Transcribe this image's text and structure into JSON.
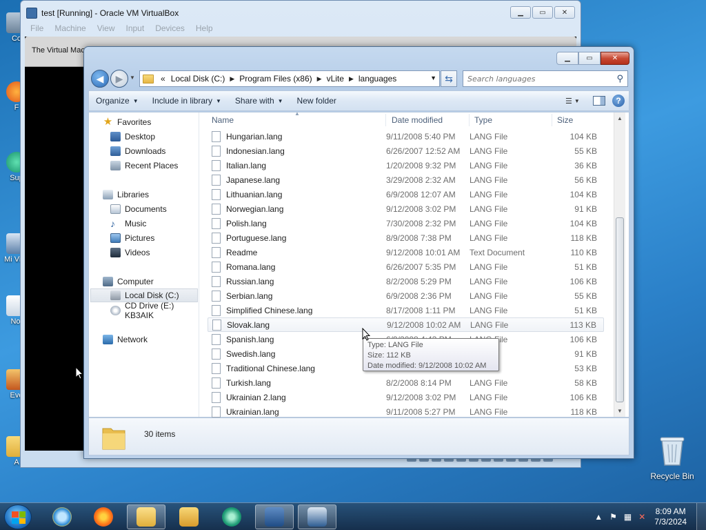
{
  "desktop": {
    "icons": [
      {
        "label": "Co"
      },
      {
        "label": "F"
      },
      {
        "label": "Sup"
      },
      {
        "label": "Mi Visu"
      },
      {
        "label": "Not"
      },
      {
        "label": "Eve"
      },
      {
        "label": "A"
      }
    ],
    "recycle_bin": "Recycle Bin"
  },
  "virtualbox": {
    "title": "test [Running] - Oracle VM VirtualBox",
    "menu": [
      "File",
      "Machine",
      "View",
      "Input",
      "Devices",
      "Help"
    ],
    "banner": "The Virtual Mac"
  },
  "explorer": {
    "breadcrumb": [
      "Local Disk (C:)",
      "Program Files (x86)",
      "vLite",
      "languages"
    ],
    "breadcrumb_prefix": "«",
    "search_placeholder": "Search languages",
    "toolbar": {
      "organize": "Organize",
      "include_in_library": "Include in library",
      "share_with": "Share with",
      "new_folder": "New folder"
    },
    "nav": {
      "favorites": "Favorites",
      "desktop": "Desktop",
      "downloads": "Downloads",
      "recent_places": "Recent Places",
      "libraries": "Libraries",
      "documents": "Documents",
      "music": "Music",
      "pictures": "Pictures",
      "videos": "Videos",
      "computer": "Computer",
      "local_disk": "Local Disk (C:)",
      "cd_drive": "CD Drive (E:) KB3AIK",
      "network": "Network"
    },
    "columns": {
      "name": "Name",
      "date": "Date modified",
      "type": "Type",
      "size": "Size"
    },
    "files": [
      {
        "name": "Hungarian.lang",
        "date": "9/11/2008 5:40 PM",
        "type": "LANG File",
        "size": "104 KB"
      },
      {
        "name": "Indonesian.lang",
        "date": "6/26/2007 12:52 AM",
        "type": "LANG File",
        "size": "55 KB"
      },
      {
        "name": "Italian.lang",
        "date": "1/20/2008 9:32 PM",
        "type": "LANG File",
        "size": "36 KB"
      },
      {
        "name": "Japanese.lang",
        "date": "3/29/2008 2:32 AM",
        "type": "LANG File",
        "size": "56 KB"
      },
      {
        "name": "Lithuanian.lang",
        "date": "6/9/2008 12:07 AM",
        "type": "LANG File",
        "size": "104 KB"
      },
      {
        "name": "Norwegian.lang",
        "date": "9/12/2008 3:02 PM",
        "type": "LANG File",
        "size": "91 KB"
      },
      {
        "name": "Polish.lang",
        "date": "7/30/2008 2:32 PM",
        "type": "LANG File",
        "size": "104 KB"
      },
      {
        "name": "Portuguese.lang",
        "date": "8/9/2008 7:38 PM",
        "type": "LANG File",
        "size": "118 KB"
      },
      {
        "name": "Readme",
        "date": "9/12/2008 10:01 AM",
        "type": "Text Document",
        "size": "110 KB"
      },
      {
        "name": "Romana.lang",
        "date": "6/26/2007 5:35 PM",
        "type": "LANG File",
        "size": "51 KB"
      },
      {
        "name": "Russian.lang",
        "date": "8/2/2008 5:29 PM",
        "type": "LANG File",
        "size": "106 KB"
      },
      {
        "name": "Serbian.lang",
        "date": "6/9/2008 2:36 PM",
        "type": "LANG File",
        "size": "55 KB"
      },
      {
        "name": "Simplified Chinese.lang",
        "date": "8/17/2008 1:11 PM",
        "type": "LANG File",
        "size": "51 KB"
      },
      {
        "name": "Slovak.lang",
        "date": "9/12/2008 10:02 AM",
        "type": "LANG File",
        "size": "113 KB"
      },
      {
        "name": "Spanish.lang",
        "date": "6/9/2008 4:43 PM",
        "type": "LANG File",
        "size": "106 KB"
      },
      {
        "name": "Swedish.lang",
        "date": "",
        "type": "",
        "size": "91 KB"
      },
      {
        "name": "Traditional Chinese.lang",
        "date": "",
        "type": "",
        "size": "53 KB"
      },
      {
        "name": "Turkish.lang",
        "date": "8/2/2008 8:14 PM",
        "type": "LANG File",
        "size": "58 KB"
      },
      {
        "name": "Ukrainian 2.lang",
        "date": "9/12/2008 3:02 PM",
        "type": "LANG File",
        "size": "106 KB"
      },
      {
        "name": "Ukrainian.lang",
        "date": "9/11/2008 5:27 PM",
        "type": "LANG File",
        "size": "118 KB"
      }
    ],
    "tooltip": {
      "type": "Type: LANG File",
      "size": "Size: 112 KB",
      "modified": "Date modified: 9/12/2008 10:02 AM"
    },
    "item_count": "30 items"
  },
  "taskbar": {
    "time": "8:09 AM",
    "date": "7/3/2024"
  },
  "colors": {
    "accent": "#3d9be0",
    "selection": "#dfe5ec",
    "close_red": "#c84a34"
  }
}
